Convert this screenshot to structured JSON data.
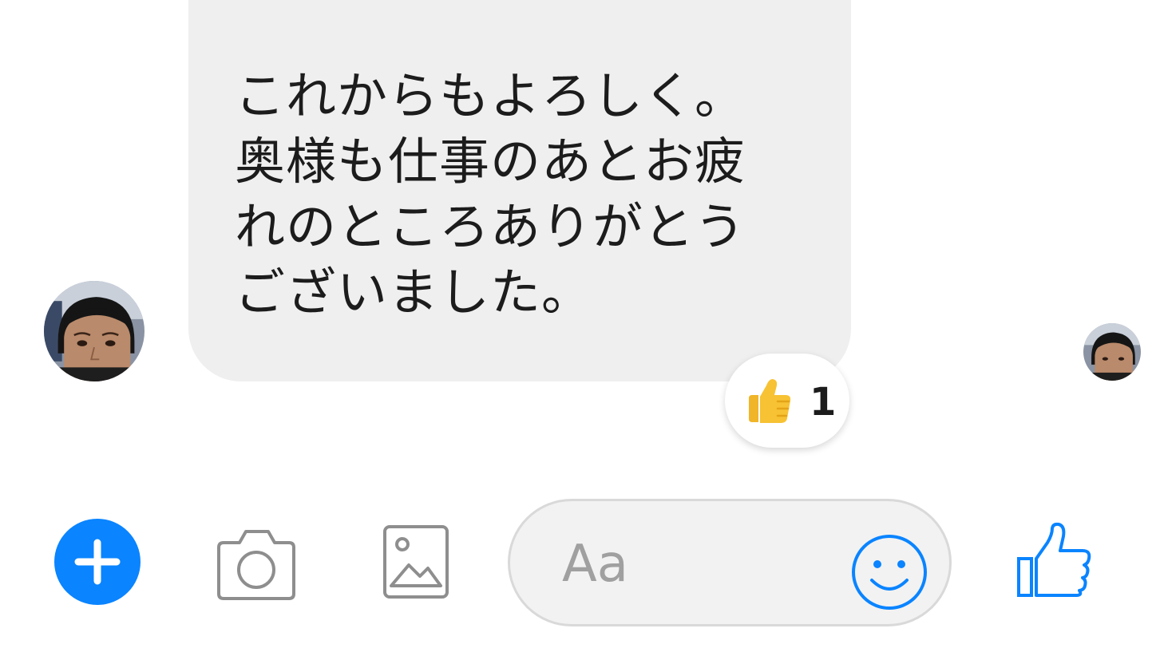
{
  "message": {
    "lines": [
      "これからもよろしく。",
      "奥様も仕事のあとお疲",
      "れのところありがとう",
      "ございました。"
    ]
  },
  "reaction": {
    "emoji_icon": "thumbs-up-emoji",
    "count": "1"
  },
  "composer": {
    "placeholder": "Aa",
    "icons": [
      "plus-icon",
      "camera-icon",
      "gallery-icon",
      "smiley-icon",
      "like-icon"
    ]
  },
  "colors": {
    "accent": "#0a84ff",
    "bubble": "#efefef",
    "emoji_yellow": "#f7c233"
  }
}
